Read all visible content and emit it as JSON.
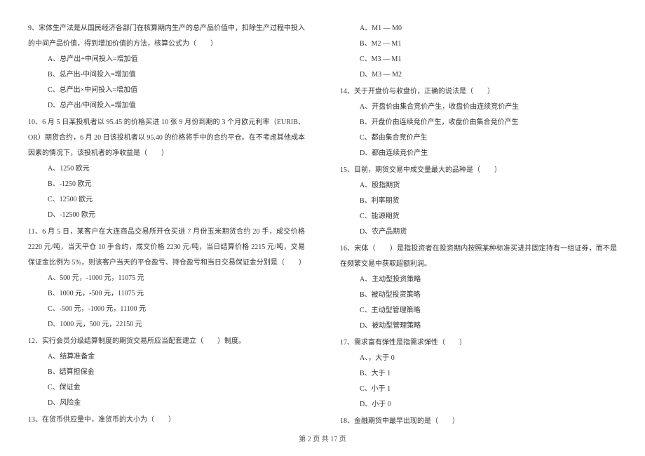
{
  "left": {
    "q9": {
      "text": "9、宋体生产法是从国民经济各部门在核算期内生产的总产品价值中，扣除生产过程中投入的中间产品价值，得到增加价值的方法，核算公式为（　　）",
      "a": "A、总产出+中间投入=增加值",
      "b": "B、总产出-中间投入=增加值",
      "c": "C、总产出×中间投入=增加值",
      "d": "D、总产出/中间投入=增加值"
    },
    "q10": {
      "text": "10、6 月 5 日某投机者以 95.45 的价格买进 10 张 9 月份到期的 3 个月欧元利率（EURIB、OR）期货合约，6 月 20 日该投机者以 95.40 的价格将手中的合约平仓。在不考虑其他成本因素的情况下，该投机者的净收益是（　　）",
      "a": "A、1250 欧元",
      "b": "B、-1250 欧元",
      "c": "C、12500 欧元",
      "d": "D、-12500 欧元"
    },
    "q11": {
      "text": "11、6 月 5 日，某客户在大连商品交易所开仓买进 7 月份玉米期货合约 20 手，成交价格 2220 元/吨，当天平仓 10 手合约，成交价格 2230 元/吨，当日结算价格 2215 元/吨，交易保证金比例为 5%，则该客户当天的平仓盈亏、持仓盈亏和当日交易保证金分别是（　　）",
      "a": "A、500 元，-1000 元，11075 元",
      "b": "B、1000 元，-500 元，11075 元",
      "c": "C、-500 元，-1000 元，11100 元",
      "d": "D、1000 元，500 元，22150 元"
    },
    "q12": {
      "text": "12、实行会员分级结算制度的期货交易所应当配套建立（　　）制度。",
      "a": "A、结算准备金",
      "b": "B、结算担保金",
      "c": "C、保证金",
      "d": "D、风险金"
    },
    "q13": {
      "text": "13、在货币供应量中，准货币的大小为（　　）"
    }
  },
  "right": {
    "q13opts": {
      "a": "A、M1 — M0",
      "b": "B、M2 — M1",
      "c": "C、M3 — M1",
      "d": "D、M3 — M2"
    },
    "q14": {
      "text": "14、关于开盘价与收盘价，正确的说法是（　　）",
      "a": "A、开盘价由集合竞价产生，收盘价由连续竞价产生",
      "b": "B、开盘价由连续竞价产生，收盘价由集合竞价产生",
      "c": "C、都由集合竞价产生",
      "d": "D、都由连续竞价产生"
    },
    "q15": {
      "text": "15、目前，期货交易中成交量最大的品种是（　　）",
      "a": "A、股指期货",
      "b": "B、利率期货",
      "c": "C、能源期货",
      "d": "D、农产品期货"
    },
    "q16": {
      "text": "16、宋体（　　）是指投资者在投资期内按照某种标准买进并固定持有一组证券，而不是在频繁交易中获取超额利润。",
      "a": "A、主动型投资策略",
      "b": "B、被动型投资策略",
      "c": "C、主动型管理策略",
      "d": "D、被动型管理策略"
    },
    "q17": {
      "text": "17、需求富有弹性是指需求弹性（　　）",
      "a": "A、，大于 0",
      "b": "B、大于 1",
      "c": "C、小于 1",
      "d": "D、小于 0"
    },
    "q18": {
      "text": "18、金融期货中最早出现的是（　　）"
    }
  },
  "footer": "第 2 页 共 17 页"
}
